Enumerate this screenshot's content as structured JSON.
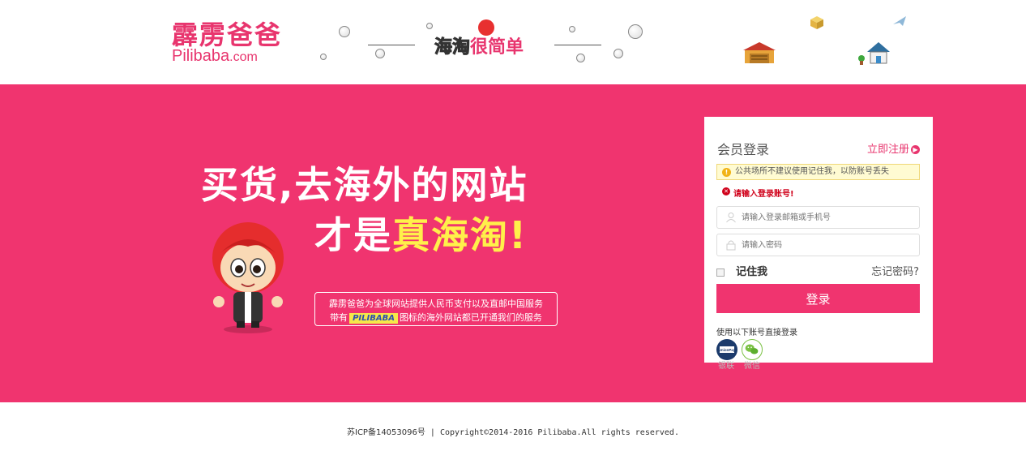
{
  "header": {
    "logo_cn": "霹雳爸爸",
    "logo_en_main": "Pilibaba",
    "logo_en_suffix": ".com",
    "slogan_outline": "海淘",
    "slogan_main": "很简单"
  },
  "banner": {
    "headline_line1": "买货,去海外的网站",
    "headline_line2_prefix": "才是",
    "headline_line2_highlight": "真海淘!",
    "info_line1": "霹雳爸爸为全球网站提供人民币支付以及直邮中国服务",
    "info_line2_prefix": "带有",
    "info_badge": "PILIBABA",
    "info_line2_suffix": "图标的海外网站都已开通我们的服务"
  },
  "login": {
    "title": "会员登录",
    "register_label": "立即注册",
    "warning": "公共场所不建议使用记住我，以防账号丢失",
    "error": "请输入登录账号!",
    "account_placeholder": "请输入登录邮箱或手机号",
    "password_placeholder": "请输入密码",
    "remember_label": "记住我",
    "forgot_label": "忘记密码?",
    "submit_label": "登录",
    "third_party_title": "使用以下账号直接登录",
    "third_party": [
      {
        "label": "银联",
        "icon": "unionpay-icon",
        "badge_text": "UnionPay"
      },
      {
        "label": "微信",
        "icon": "wechat-icon"
      }
    ]
  },
  "footer": {
    "icp": "苏ICP备14053096号",
    "separator": "|",
    "copyright": "Copyright©2014-2016 Pilibaba.All rights reserved."
  },
  "colors": {
    "brand_pink": "#f0346f",
    "highlight_yellow": "#fff04a",
    "error_red": "#d0021b"
  }
}
